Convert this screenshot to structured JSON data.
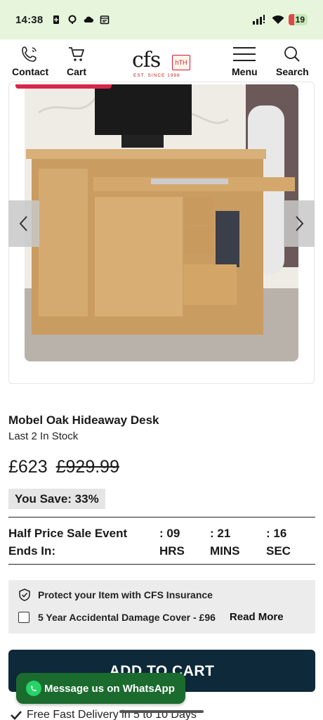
{
  "status_bar": {
    "time": "14:38",
    "battery": "19",
    "icons": [
      "battery-saver-icon",
      "sync-icon",
      "cloud-icon",
      "calendar-icon",
      "signal-icon",
      "wifi-icon"
    ]
  },
  "header": {
    "contact_label": "Contact",
    "cart_label": "Cart",
    "logo_text": "cfs",
    "logo_badge": "hTH",
    "logo_est": "EST. SINCE 1998",
    "menu_label": "Menu",
    "search_label": "Search"
  },
  "gallery": {
    "prev_icon": "chevron-left-icon",
    "next_icon": "chevron-right-icon"
  },
  "product": {
    "title": "Mobel Oak Hideaway Desk",
    "stock": "Last 2 In Stock",
    "price_now": "£623",
    "price_was": "£929.99",
    "savings": "You Save: 33%"
  },
  "timer": {
    "label_line1": "Half Price Sale Event",
    "label_line2": "Ends In:",
    "hours_value": ": 09",
    "hours_label": "HRS",
    "mins_value": ": 21",
    "mins_label": "MINS",
    "secs_value": ": 16",
    "secs_label": "SEC"
  },
  "insurance": {
    "headline": "Protect your Item with CFS Insurance",
    "option_label": "5 Year Accidental Damage Cover - £96",
    "read_more": "Read More"
  },
  "actions": {
    "add_to_cart": "ADD TO CART",
    "whatsapp": "Message us on WhatsApp",
    "delivery": "Free Fast Delivery in 5 to 10 Days"
  },
  "colors": {
    "status_bg": "#e6f5dc",
    "accent_pink": "#d9264a",
    "cart_button": "#0e2a3a",
    "whatsapp_green": "#1b6b2e"
  }
}
